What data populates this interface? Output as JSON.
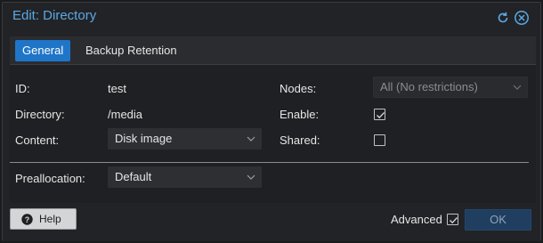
{
  "window": {
    "title": "Edit: Directory"
  },
  "tabs": [
    {
      "label": "General",
      "active": true
    },
    {
      "label": "Backup Retention",
      "active": false
    }
  ],
  "form": {
    "id_label": "ID:",
    "id_value": "test",
    "directory_label": "Directory:",
    "directory_value": "/media",
    "content_label": "Content:",
    "content_value": "Disk image",
    "nodes_label": "Nodes:",
    "nodes_placeholder": "All (No restrictions)",
    "enable_label": "Enable:",
    "enable_checked": true,
    "shared_label": "Shared:",
    "shared_checked": false,
    "preallocation_label": "Preallocation:",
    "preallocation_value": "Default"
  },
  "footer": {
    "help_label": "Help",
    "advanced_label": "Advanced",
    "advanced_checked": true,
    "ok_label": "OK"
  },
  "colors": {
    "accent": "#1f75c8",
    "title": "#5aa9e6",
    "background": "#222326"
  },
  "icons": {
    "reset": "reset-icon",
    "close": "close-icon",
    "help": "help-icon",
    "chevron": "chevron-down-icon",
    "check": "checkmark-icon"
  }
}
